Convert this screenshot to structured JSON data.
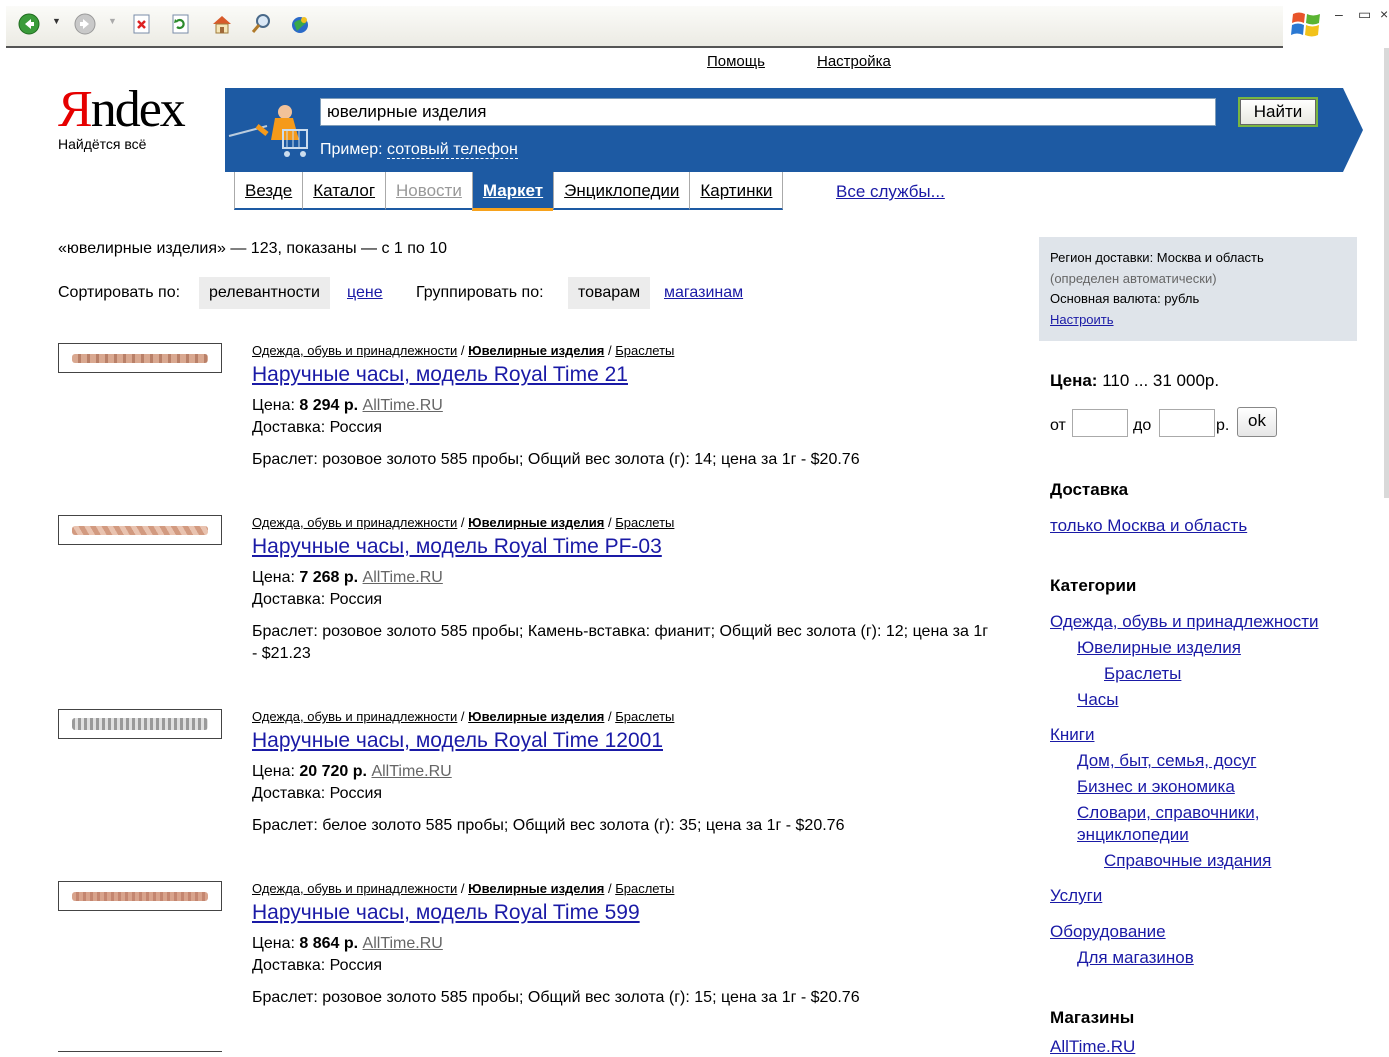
{
  "top_links": {
    "help": "Помощь",
    "settings": "Настройка"
  },
  "logo": {
    "first_letter": "Я",
    "rest": "ndex",
    "tagline": "Найдётся всё"
  },
  "search": {
    "query": "ювелирные изделия",
    "button": "Найти",
    "example_label": "Пример:",
    "example_link": "сотовый телефон"
  },
  "tabs": [
    {
      "label": "Везде",
      "state": "normal"
    },
    {
      "label": "Каталог",
      "state": "normal"
    },
    {
      "label": "Новости",
      "state": "dim"
    },
    {
      "label": "Маркет",
      "state": "active"
    },
    {
      "label": "Энциклопедии",
      "state": "normal"
    },
    {
      "label": "Картинки",
      "state": "normal"
    }
  ],
  "all_services": "Все службы...",
  "summary": "«ювелирные изделия» — 123, показаны — с 1 по 10",
  "sort": {
    "label": "Сортировать по:",
    "relevance": "релевантности",
    "price": "цене",
    "group_label": "Группировать по:",
    "goods": "товарам",
    "shops": "магазинам"
  },
  "results": [
    {
      "crumb1": "Одежда, обувь и принадлежности",
      "crumb2": "Ювелирные изделия",
      "crumb3": "Браслеты",
      "title": "Наручные часы, модель Royal Time 21",
      "price_label": "Цена:",
      "price": "8 294 р.",
      "shop": "AllTime.RU",
      "delivery": "Доставка: Россия",
      "desc": "Браслет: розовое золото 585 пробы; Общий вес золота (г): 14; цена за 1г - $20.76"
    },
    {
      "crumb1": "Одежда, обувь и принадлежности",
      "crumb2": "Ювелирные изделия",
      "crumb3": "Браслеты",
      "title": "Наручные часы, модель Royal Time PF-03",
      "price_label": "Цена:",
      "price": "7 268 р.",
      "shop": "AllTime.RU",
      "delivery": "Доставка: Россия",
      "desc": "Браслет: розовое золото 585 пробы; Камень-вставка: фианит; Общий вес золота (г): 12; цена за 1г - $21.23"
    },
    {
      "crumb1": "Одежда, обувь и принадлежности",
      "crumb2": "Ювелирные изделия",
      "crumb3": "Браслеты",
      "title": "Наручные часы, модель Royal Time 12001",
      "price_label": "Цена:",
      "price": "20 720 р.",
      "shop": "AllTime.RU",
      "delivery": "Доставка: Россия",
      "desc": "Браслет: белое золото 585 пробы; Общий вес золота (г): 35; цена за 1г - $20.76"
    },
    {
      "crumb1": "Одежда, обувь и принадлежности",
      "crumb2": "Ювелирные изделия",
      "crumb3": "Браслеты",
      "title": "Наручные часы, модель Royal Time 599",
      "price_label": "Цена:",
      "price": "8 864 р.",
      "shop": "AllTime.RU",
      "delivery": "Доставка: Россия",
      "desc": "Браслет: розовое золото 585 пробы; Общий вес золота (г): 15; цена за 1г - $20.76"
    }
  ],
  "region": {
    "line1": "Регион доставки: Москва и область",
    "line2": "(определен автоматически)",
    "line3": "Основная валюта: рубль",
    "configure": "Настроить"
  },
  "price_filter": {
    "label": "Цена:",
    "range": "110 ... 31 000р.",
    "from": "от",
    "to": "до",
    "currency": "р.",
    "ok": "ok"
  },
  "delivery_filter": {
    "heading": "Доставка",
    "link": "только Москва и область"
  },
  "categories": {
    "heading": "Категории",
    "items": [
      "Одежда, обувь и принадлежности",
      "Ювелирные изделия",
      "Браслеты",
      "Часы",
      "Книги",
      "Дом, быт, семья, досуг",
      "Бизнес и экономика",
      "Словари, справочники,",
      "энциклопедии",
      "Справочные издания",
      "Услуги",
      "Оборудование",
      "Для магазинов"
    ]
  },
  "shops": {
    "heading": "Магазины",
    "first": "AllTime.RU"
  },
  "colors": {
    "brand_red": "#e60000",
    "band_blue": "#1d5aa3",
    "link": "#1a1aa6",
    "tab_accent": "#f7a21c"
  }
}
